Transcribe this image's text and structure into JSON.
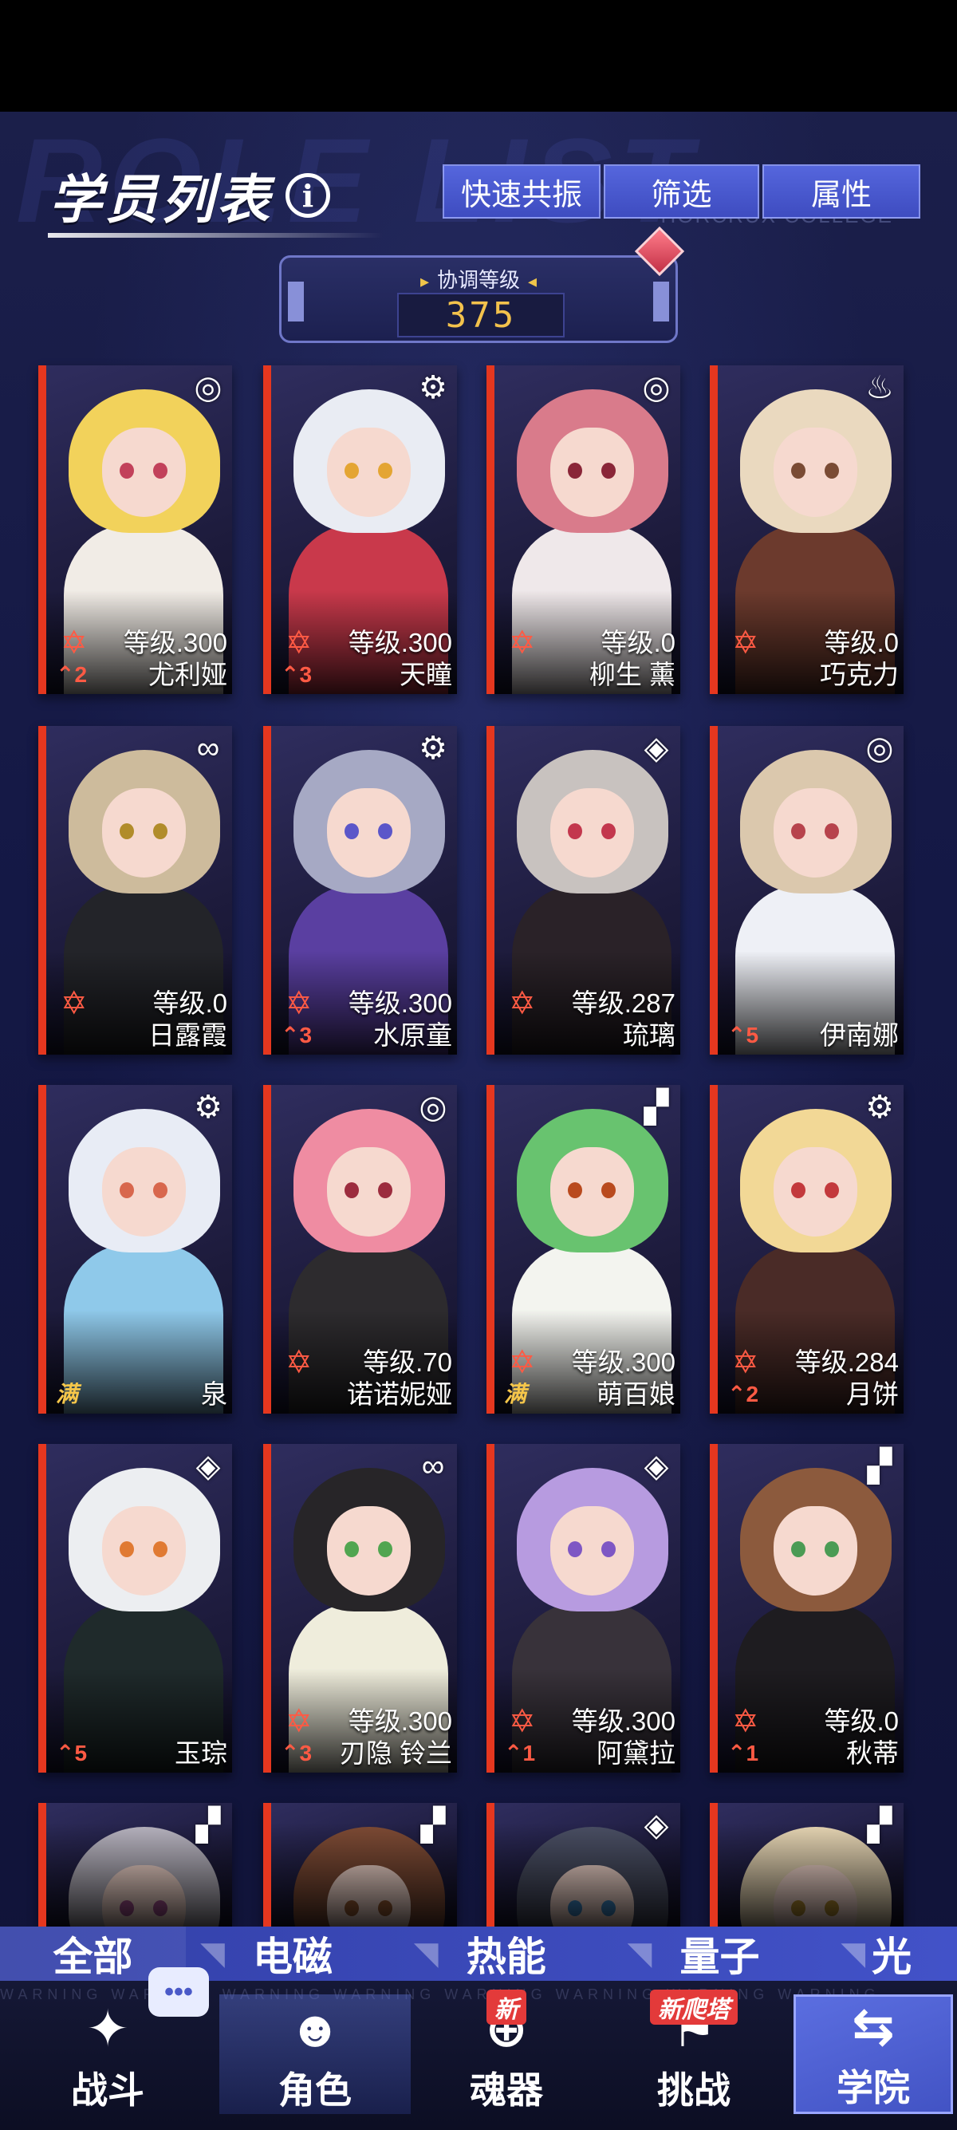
{
  "header": {
    "title": "学员列表",
    "info_icon": "i",
    "buttons": [
      "快速共振",
      "筛选",
      "属性"
    ]
  },
  "background": {
    "watermark": "ROLE LIST",
    "subtitle": "HORCRUX COLLEGE"
  },
  "level_panel": {
    "label": "协调等级",
    "value": "375"
  },
  "cards": [
    {
      "name": "尤利娅",
      "level": "等级.300",
      "rank": "2",
      "element": "swirl-icon",
      "glyph": "◎",
      "hair": "#f2d25b",
      "body": "#f1ece6",
      "eye": "#c2415a"
    },
    {
      "name": "天瞳",
      "level": "等级.300",
      "rank": "3",
      "element": "gear-icon",
      "glyph": "⚙",
      "hair": "#e9ecf3",
      "body": "#c9394b",
      "eye": "#e4a533"
    },
    {
      "name": "柳生 薰",
      "level": "等级.0",
      "rank": "",
      "element": "swirl-icon",
      "glyph": "◎",
      "hair": "#d97b8b",
      "body": "#efe8ea",
      "eye": "#8a2638"
    },
    {
      "name": "巧克力",
      "level": "等级.0",
      "rank": "",
      "element": "flame-icon",
      "glyph": "♨",
      "hair": "#ead9bf",
      "body": "#6c3a2d",
      "eye": "#7a4b34"
    },
    {
      "name": "日露霞",
      "level": "等级.0",
      "rank": "",
      "element": "infinity-icon",
      "glyph": "∞",
      "hair": "#cdbb9c",
      "body": "#232429",
      "eye": "#b18c2a"
    },
    {
      "name": "水原童",
      "level": "等级.300",
      "rank": "3",
      "element": "gear-icon",
      "glyph": "⚙",
      "hair": "#a6a9c4",
      "body": "#5a3fa1",
      "eye": "#5b56c9"
    },
    {
      "name": "琉璃",
      "level": "等级.287",
      "rank": "",
      "element": "diamond-icon",
      "glyph": "◈",
      "hair": "#c8c2bf",
      "body": "#2a2228",
      "eye": "#c3374d"
    },
    {
      "name": "伊南娜",
      "level": "",
      "rank": "5",
      "element": "swirl-icon",
      "glyph": "◎",
      "hair": "#dbc8ad",
      "body": "#eef0f6",
      "eye": "#b7434c"
    },
    {
      "name": "泉",
      "level": "",
      "rank": "满",
      "element": "gear-icon",
      "glyph": "⚙",
      "hair": "#e8ecf5",
      "body": "#8fc9ea",
      "eye": "#d8674d"
    },
    {
      "name": "诺诺妮娅",
      "level": "等级.70",
      "rank": "",
      "element": "swirl-icon",
      "glyph": "◎",
      "hair": "#ef8ca2",
      "body": "#2d2b2e",
      "eye": "#9c2c3e"
    },
    {
      "name": "萌百娘",
      "level": "等级.300",
      "rank": "满",
      "element": "stripe-icon",
      "glyph": "▞",
      "hair": "#68c36f",
      "body": "#f3f4ef",
      "eye": "#b94a1e"
    },
    {
      "name": "月饼",
      "level": "等级.284",
      "rank": "2",
      "element": "gear-icon",
      "glyph": "⚙",
      "hair": "#f2d896",
      "body": "#4a2b27",
      "eye": "#c3393c"
    },
    {
      "name": "玉琮",
      "level": "",
      "rank": "5",
      "element": "diamond-icon",
      "glyph": "◈",
      "hair": "#eceef1",
      "body": "#1f2a2b",
      "eye": "#e07a33"
    },
    {
      "name": "刃隐 铃兰",
      "level": "等级.300",
      "rank": "3",
      "element": "infinity-icon",
      "glyph": "∞",
      "hair": "#272528",
      "body": "#efeddc",
      "eye": "#51a550"
    },
    {
      "name": "阿黛拉",
      "level": "等级.300",
      "rank": "1",
      "element": "diamond-icon",
      "glyph": "◈",
      "hair": "#b79be0",
      "body": "#38323a",
      "eye": "#7e57c4"
    },
    {
      "name": "秋蒂",
      "level": "等级.0",
      "rank": "1",
      "element": "stripe-icon",
      "glyph": "▞",
      "hair": "#8c5a3d",
      "body": "#1e1c20",
      "eye": "#4b9b54"
    },
    {
      "name": "",
      "level": "",
      "rank": "",
      "element": "stripe-icon",
      "glyph": "▞",
      "hair": "#b8b4c0",
      "body": "#3a3542",
      "eye": "#a24f8e"
    },
    {
      "name": "",
      "level": "",
      "rank": "",
      "element": "stripe-icon",
      "glyph": "▞",
      "hair": "#7e4b35",
      "body": "#2c2528",
      "eye": "#9a5c33"
    },
    {
      "name": "",
      "level": "",
      "rank": "",
      "element": "diamond-icon",
      "glyph": "◈",
      "hair": "#4a4f64",
      "body": "#e9e7ef",
      "eye": "#3b86c4"
    },
    {
      "name": "",
      "level": "",
      "rank": "",
      "element": "stripe-icon",
      "glyph": "▞",
      "hair": "#e7d6b4",
      "body": "#d9c6a4",
      "eye": "#b18a2f"
    }
  ],
  "element_tabs": [
    "全部",
    "电磁",
    "热能",
    "量子",
    "光"
  ],
  "bottom_nav": {
    "items": [
      {
        "label": "战斗",
        "icon": "battle-icon",
        "glyph": "✦"
      },
      {
        "label": "角色",
        "icon": "characters-icon",
        "glyph": "☻"
      },
      {
        "label": "魂器",
        "icon": "soul-icon",
        "glyph": "⊕",
        "badge": "新"
      },
      {
        "label": "挑战",
        "icon": "challenge-icon",
        "glyph": "⚑",
        "badge": "新爬塔"
      },
      {
        "label": "学院",
        "icon": "academy-icon",
        "glyph": "⇆"
      }
    ],
    "chat_glyph": "•••",
    "warning_text": "WARNING   WARNING   WARNING   WARNING   WARNING   WARNING   WARNING   WARNING"
  }
}
